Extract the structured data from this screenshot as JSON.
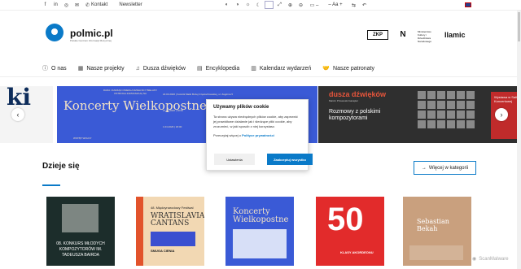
{
  "topbar": {
    "social": [
      "f",
      "in",
      "◎",
      "✉",
      "✆"
    ],
    "links": [
      "Kontakt",
      "Newsletter"
    ],
    "a11y": [
      "◐",
      "◑",
      "☼",
      "☾",
      "",
      "⤢",
      "⊕",
      "⊖",
      "▭ –",
      "– Aa +",
      "⇆",
      "↶"
    ]
  },
  "header": {
    "logo_text": "polmic.pl",
    "logo_sub": "Polskie Centrum Informacji Muzycznej",
    "partners": [
      "ZKP",
      "N",
      "Ministerstwo Kultury i Dziedzictwa Narodowego",
      "Ilamic"
    ]
  },
  "nav": [
    {
      "icon": "ⓘ",
      "label": "O nas"
    },
    {
      "icon": "▦",
      "label": "Nasze projekty"
    },
    {
      "icon": "♫",
      "label": "Dusza dźwięków"
    },
    {
      "icon": "▤",
      "label": "Encyklopedia"
    },
    {
      "icon": "▥",
      "label": "Kalendarz wydarzeń"
    },
    {
      "icon": "🤝",
      "label": "Nasze patronaty"
    }
  ],
  "slider": {
    "s0_text": "ki",
    "s1_title": "Koncerty Wielkopostne",
    "s1_top": "RADA I ZARZĄD OSIEDLA DZIELNICY BIELANY OSTROGA ZAPRASZAJĄ NA",
    "s1_dates": [
      "22.03.2026 | Kościół Matki Bożej Częstochowskiej, ul. Zagórna 5",
      "27.03.2026 | 18:00",
      "1.04.2026 | 18:00"
    ],
    "s1_footer": "WSTĘP WOLNY",
    "s2_title": "dusza dźwięków",
    "s2_sub": "Marcin Przewoski Garapler",
    "s2_text": "Rozmowy z polskimi kompozytorami",
    "s2_side": "Wystawa w Sali Koncertowej"
  },
  "section": {
    "title": "Dzieje się",
    "more_label": "Więcej w kategorii"
  },
  "cards": {
    "c1": "08. KONKURS MŁODYCH KOMPOZYTORÓW IM. TADEUSZA BAIRDA",
    "c2_top": "48. Międzynarodowy Festiwal",
    "c2_title": "WRATISLAVIA CANTANS",
    "c2_bottom": "SMUGA CIENIA",
    "c3_title": "Koncerty Wielkopostne",
    "c4_num": "50",
    "c4_sub": "KLASY AKORDEONU",
    "c5_title": "Sebastian Bekah"
  },
  "cookie": {
    "title": "Używamy plików cookie",
    "body": "Ta strona używa niezbędnych plików cookie, aby zapewnić jej prawidłowe działanie jak i śledzące pliki cookie, aby zrozumieć, w jaki sposób z niej korzystasz.",
    "policy_prefix": "Przeczytaj więcej o",
    "policy_link": "Polityce prywatności",
    "btn_settings": "Ustawienia",
    "btn_accept": "Zaakceptuj wszystko"
  },
  "watermark": "ScanMalware"
}
